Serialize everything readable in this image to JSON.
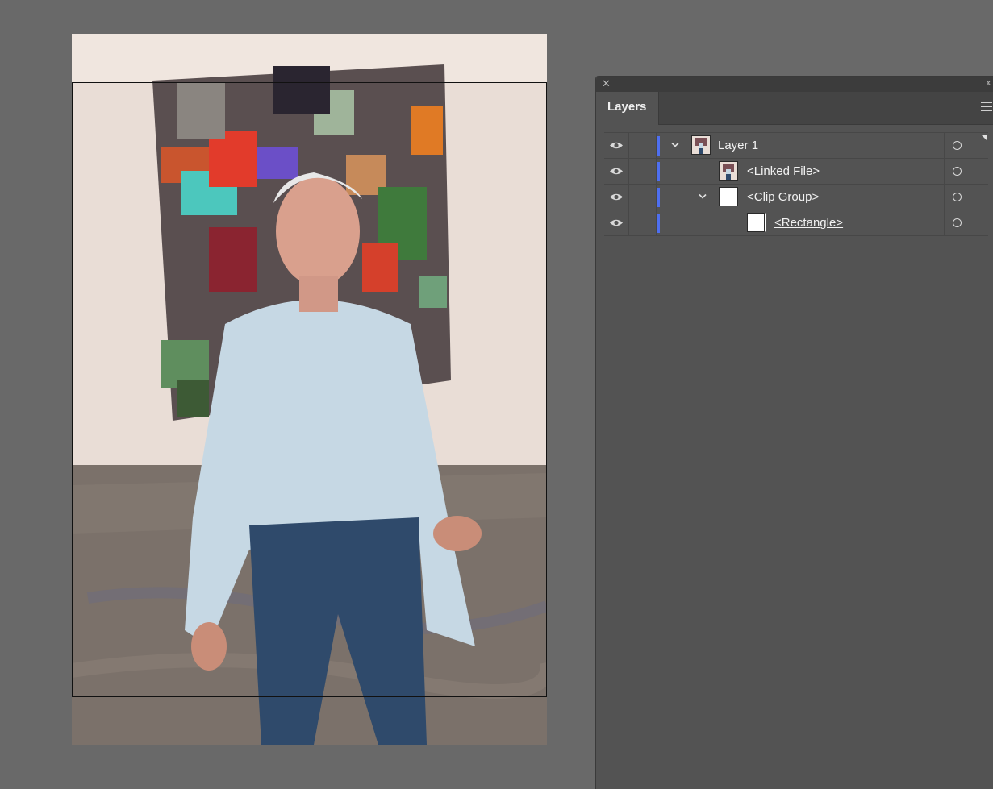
{
  "panel": {
    "close_icon": "close-icon",
    "collapse_icon": "collapse-double-chevron-icon",
    "tab_label": "Layers",
    "menu_icon": "hamburger-menu-icon"
  },
  "layers": [
    {
      "label": "Layer 1",
      "expanded": true,
      "thumb": "photo-thumbnail",
      "underlined": false
    },
    {
      "label": "<Linked File>",
      "thumb": "photo-thumbnail",
      "underlined": false
    },
    {
      "label": "<Clip Group>",
      "expanded": true,
      "thumb": "white-thumbnail",
      "underlined": false
    },
    {
      "label": "<Rectangle>",
      "thumb": "white-thumbnail",
      "underlined": true
    }
  ],
  "colors": {
    "layer_color": "#4e6ff0",
    "panel_bg": "#535353",
    "canvas_bg": "#696969"
  }
}
